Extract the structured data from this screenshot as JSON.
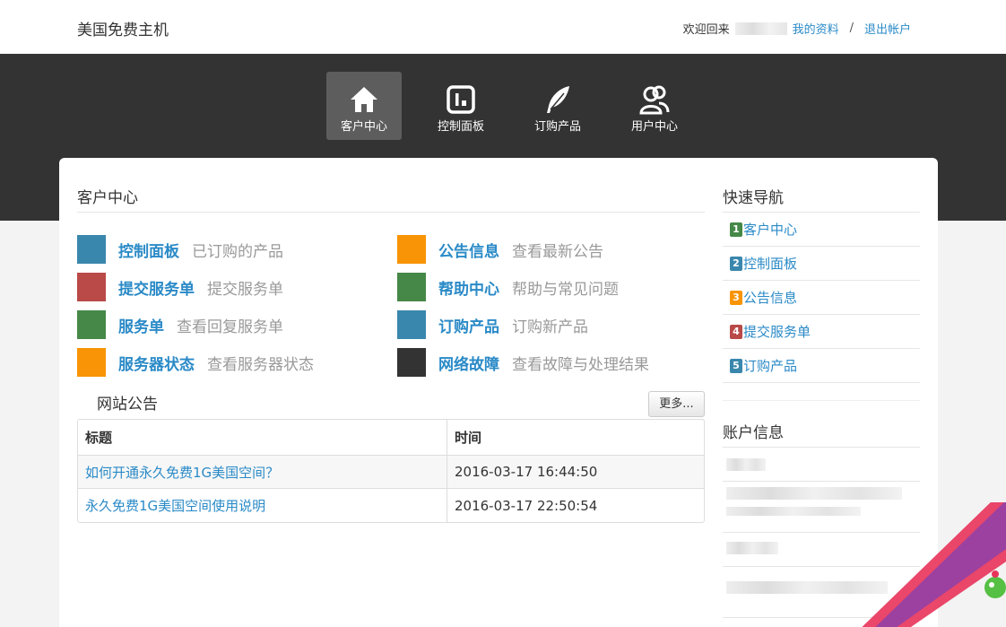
{
  "header": {
    "site_title": "美国免费主机",
    "welcome": "欢迎回来",
    "sep1": "/",
    "my_profile": "我的资料",
    "sep2": "/",
    "logout": "退出帐户"
  },
  "nav": [
    {
      "label": "客户中心",
      "icon": "home-icon",
      "active": true
    },
    {
      "label": "控制面板",
      "icon": "dashboard-icon",
      "active": false
    },
    {
      "label": "订购产品",
      "icon": "feather-icon",
      "active": false
    },
    {
      "label": "用户中心",
      "icon": "users-icon",
      "active": false
    }
  ],
  "main": {
    "section_title": "客户中心",
    "tiles": [
      {
        "name": "控制面板",
        "desc": "已订购的产品",
        "color": "#3a87ad"
      },
      {
        "name": "提交服务单",
        "desc": "提交服务单",
        "color": "#b94a48"
      },
      {
        "name": "服务单",
        "desc": "查看回复服务单",
        "color": "#468847"
      },
      {
        "name": "服务器状态",
        "desc": "查看服务器状态",
        "color": "#f89406"
      },
      {
        "name": "公告信息",
        "desc": "查看最新公告",
        "color": "#f89406"
      },
      {
        "name": "帮助中心",
        "desc": "帮助与常见问题",
        "color": "#468847"
      },
      {
        "name": "订购产品",
        "desc": "订购新产品",
        "color": "#3a87ad"
      },
      {
        "name": "网络故障",
        "desc": "查看故障与处理结果",
        "color": "#333333"
      }
    ],
    "notice_title": "网站公告",
    "more_button": "更多...",
    "table": {
      "headers": [
        "标题",
        "时间"
      ],
      "rows": [
        {
          "title": "如何开通永久免费1G美国空间？",
          "time": "2016-03-17 16:44:50"
        },
        {
          "title": "永久免费1G美国空间使用说明",
          "time": "2016-03-17 22:50:54"
        }
      ]
    }
  },
  "sidebar": {
    "quick_nav_title": "快速导航",
    "quick_nav": [
      {
        "num": "1",
        "label": "客户中心",
        "color": "#468847"
      },
      {
        "num": "2",
        "label": "控制面板",
        "color": "#3a87ad"
      },
      {
        "num": "3",
        "label": "公告信息",
        "color": "#f89406"
      },
      {
        "num": "4",
        "label": "提交服务单",
        "color": "#b94a48"
      },
      {
        "num": "5",
        "label": "订购产品",
        "color": "#3a87ad"
      }
    ],
    "account_title": "账户信息"
  },
  "colors": {
    "link": "#2a8ac7",
    "dark_band": "#333333",
    "nav_active": "#5d5d5d"
  }
}
